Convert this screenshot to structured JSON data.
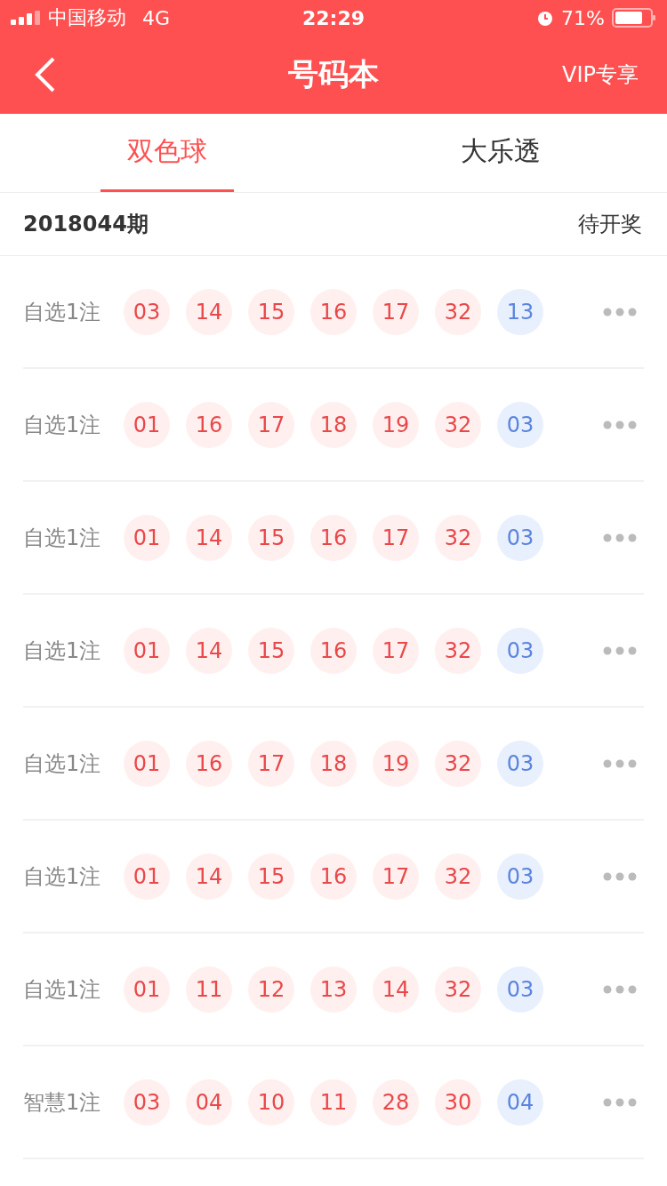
{
  "status_bar": {
    "carrier": "中国移动",
    "network": "4G",
    "time": "22:29",
    "battery": "71%"
  },
  "nav": {
    "title": "号码本",
    "action": "VIP专享"
  },
  "tabs": [
    {
      "label": "双色球",
      "selected": true
    },
    {
      "label": "大乐透",
      "selected": false
    }
  ],
  "period": {
    "issue": "2018044期",
    "status": "待开奖"
  },
  "rows": [
    {
      "label": "自选1注",
      "balls": [
        {
          "number": "03",
          "kind": "red"
        },
        {
          "number": "14",
          "kind": "red"
        },
        {
          "number": "15",
          "kind": "red"
        },
        {
          "number": "16",
          "kind": "red"
        },
        {
          "number": "17",
          "kind": "red"
        },
        {
          "number": "32",
          "kind": "red"
        },
        {
          "number": "13",
          "kind": "blue"
        }
      ]
    },
    {
      "label": "自选1注",
      "balls": [
        {
          "number": "01",
          "kind": "red"
        },
        {
          "number": "16",
          "kind": "red"
        },
        {
          "number": "17",
          "kind": "red"
        },
        {
          "number": "18",
          "kind": "red"
        },
        {
          "number": "19",
          "kind": "red"
        },
        {
          "number": "32",
          "kind": "red"
        },
        {
          "number": "03",
          "kind": "blue"
        }
      ]
    },
    {
      "label": "自选1注",
      "balls": [
        {
          "number": "01",
          "kind": "red"
        },
        {
          "number": "14",
          "kind": "red"
        },
        {
          "number": "15",
          "kind": "red"
        },
        {
          "number": "16",
          "kind": "red"
        },
        {
          "number": "17",
          "kind": "red"
        },
        {
          "number": "32",
          "kind": "red"
        },
        {
          "number": "03",
          "kind": "blue"
        }
      ]
    },
    {
      "label": "自选1注",
      "balls": [
        {
          "number": "01",
          "kind": "red"
        },
        {
          "number": "14",
          "kind": "red"
        },
        {
          "number": "15",
          "kind": "red"
        },
        {
          "number": "16",
          "kind": "red"
        },
        {
          "number": "17",
          "kind": "red"
        },
        {
          "number": "32",
          "kind": "red"
        },
        {
          "number": "03",
          "kind": "blue"
        }
      ]
    },
    {
      "label": "自选1注",
      "balls": [
        {
          "number": "01",
          "kind": "red"
        },
        {
          "number": "16",
          "kind": "red"
        },
        {
          "number": "17",
          "kind": "red"
        },
        {
          "number": "18",
          "kind": "red"
        },
        {
          "number": "19",
          "kind": "red"
        },
        {
          "number": "32",
          "kind": "red"
        },
        {
          "number": "03",
          "kind": "blue"
        }
      ]
    },
    {
      "label": "自选1注",
      "balls": [
        {
          "number": "01",
          "kind": "red"
        },
        {
          "number": "14",
          "kind": "red"
        },
        {
          "number": "15",
          "kind": "red"
        },
        {
          "number": "16",
          "kind": "red"
        },
        {
          "number": "17",
          "kind": "red"
        },
        {
          "number": "32",
          "kind": "red"
        },
        {
          "number": "03",
          "kind": "blue"
        }
      ]
    },
    {
      "label": "自选1注",
      "balls": [
        {
          "number": "01",
          "kind": "red"
        },
        {
          "number": "11",
          "kind": "red"
        },
        {
          "number": "12",
          "kind": "red"
        },
        {
          "number": "13",
          "kind": "red"
        },
        {
          "number": "14",
          "kind": "red"
        },
        {
          "number": "32",
          "kind": "red"
        },
        {
          "number": "03",
          "kind": "blue"
        }
      ]
    },
    {
      "label": "智慧1注",
      "balls": [
        {
          "number": "03",
          "kind": "red"
        },
        {
          "number": "04",
          "kind": "red"
        },
        {
          "number": "10",
          "kind": "red"
        },
        {
          "number": "11",
          "kind": "red"
        },
        {
          "number": "28",
          "kind": "red"
        },
        {
          "number": "30",
          "kind": "red"
        },
        {
          "number": "04",
          "kind": "blue"
        }
      ]
    }
  ]
}
